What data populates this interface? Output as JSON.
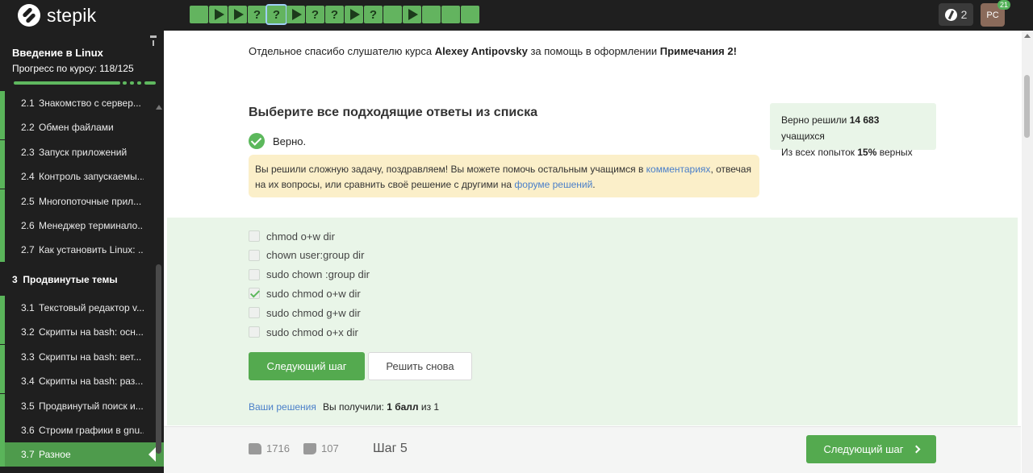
{
  "header": {
    "logo_text": "stepik",
    "steps": [
      {
        "kind": "done",
        "label": ""
      },
      {
        "kind": "play",
        "label": ""
      },
      {
        "kind": "play",
        "label": ""
      },
      {
        "kind": "quiz",
        "label": "?"
      },
      {
        "kind": "quiz-current",
        "label": "?"
      },
      {
        "kind": "play",
        "label": ""
      },
      {
        "kind": "quiz",
        "label": "?"
      },
      {
        "kind": "quiz",
        "label": "?"
      },
      {
        "kind": "play",
        "label": ""
      },
      {
        "kind": "quiz",
        "label": "?"
      },
      {
        "kind": "done",
        "label": ""
      },
      {
        "kind": "play",
        "label": ""
      },
      {
        "kind": "done",
        "label": ""
      },
      {
        "kind": "done",
        "label": ""
      },
      {
        "kind": "done",
        "label": ""
      }
    ],
    "reputation": "2",
    "avatar_initials": "PC",
    "notifications": "21",
    "accent_color": "#63b45f"
  },
  "sidebar": {
    "course_title": "Введение в Linux",
    "progress_text": "Прогресс по курсу:  118/125",
    "progress_fraction": 0.944,
    "lessons_top": [
      {
        "num": "2.1",
        "label": "Знакомство с сервер..."
      },
      {
        "num": "2.2",
        "label": "Обмен файлами"
      },
      {
        "num": "2.3",
        "label": "Запуск приложений"
      },
      {
        "num": "2.4",
        "label": "Контроль запускаемы..."
      },
      {
        "num": "2.5",
        "label": "Многопоточные прил..."
      },
      {
        "num": "2.6",
        "label": "Менеджер терминало..."
      },
      {
        "num": "2.7",
        "label": "Как установить Linux: ..."
      }
    ],
    "section": {
      "num": "3",
      "label": "Продвинутые темы"
    },
    "lessons_bottom": [
      {
        "num": "3.1",
        "label": "Текстовый редактор v..."
      },
      {
        "num": "3.2",
        "label": "Скрипты на bash: осн..."
      },
      {
        "num": "3.3",
        "label": "Скрипты на bash: вет..."
      },
      {
        "num": "3.4",
        "label": "Скрипты на bash: раз..."
      },
      {
        "num": "3.5",
        "label": "Продвинутый поиск и..."
      },
      {
        "num": "3.6",
        "label": "Строим графики в gnu..."
      },
      {
        "num": "3.7",
        "label": "Разное"
      }
    ]
  },
  "main": {
    "thanks_prefix": "Отдельное спасибо слушателю курса ",
    "thanks_name": "Alexey Antipovsky",
    "thanks_middle": " за помощь в оформлении ",
    "thanks_note": "Примечания 2!",
    "question_title": "Выберите все подходящие ответы из списка",
    "correct_label": "Верно.",
    "congrats_prefix": "Вы решили сложную задачу, поздравляем! Вы можете помочь остальным учащимся в ",
    "congrats_link1": "комментариях",
    "congrats_middle": ", отвечая на их вопросы, или сравнить своё решение с другими на ",
    "congrats_link2": "форуме решений",
    "congrats_suffix": ".",
    "stats_line1_prefix": "Верно решили ",
    "stats_line1_count": "14 683",
    "stats_line1_suffix": " учащихся",
    "stats_line2_prefix": "Из всех попыток ",
    "stats_line2_percent": "15%",
    "stats_line2_suffix": " верных",
    "options": [
      {
        "label": "chmod o+w dir",
        "checked": false
      },
      {
        "label": "chown user:group dir",
        "checked": false
      },
      {
        "label": "sudo chown :group dir",
        "checked": false
      },
      {
        "label": "sudo chmod o+w dir",
        "checked": true
      },
      {
        "label": "sudo chmod g+w dir",
        "checked": false
      },
      {
        "label": "sudo chmod o+x dir",
        "checked": false
      }
    ],
    "next_button": "Следующий шаг",
    "retry_button": "Решить снова",
    "solutions_link": "Ваши решения",
    "score_prefix": "Вы получили: ",
    "score_value": "1 балл",
    "score_suffix": " из 1"
  },
  "footer": {
    "likes": "1716",
    "dislikes": "107",
    "step_label": "Шаг 5",
    "next_button": "Следующий шаг"
  }
}
